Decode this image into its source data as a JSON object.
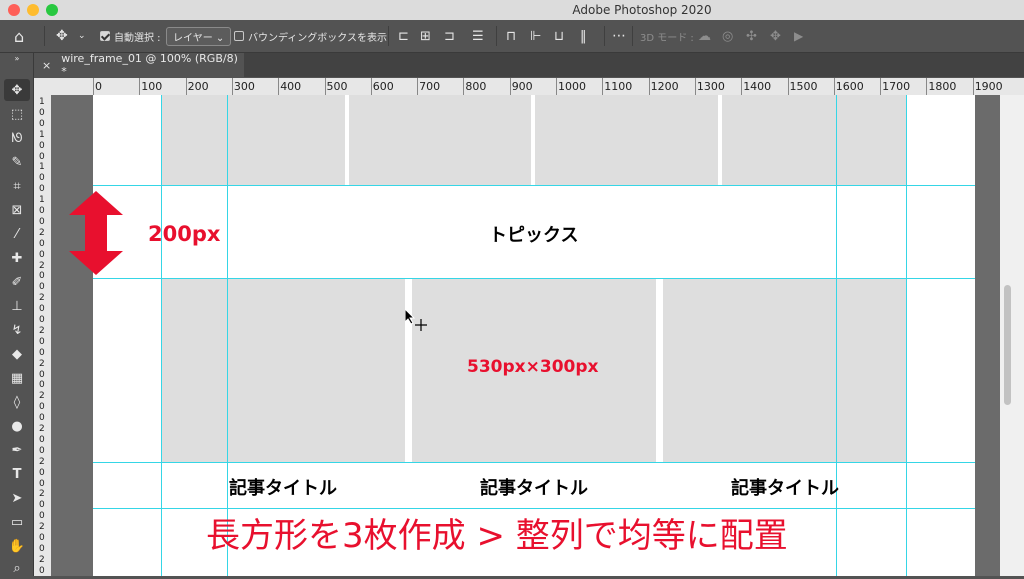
{
  "titlebar": {
    "title": "Adobe Photoshop 2020"
  },
  "options": {
    "auto_select": "自動選択 :",
    "layer_select": "レイヤー",
    "show_bbox": "バウンディングボックスを表示",
    "mode_3d": "3D モード :"
  },
  "document": {
    "tab_title": "wire_frame_01 @ 100% (RGB/8) *"
  },
  "ruler_h": [
    "0",
    "100",
    "200",
    "300",
    "400",
    "500",
    "600",
    "700",
    "800",
    "900",
    "1000",
    "1100",
    "1200",
    "1300",
    "1400",
    "1500",
    "1600",
    "1700",
    "1800",
    "1900"
  ],
  "ruler_v_digits": [
    "1",
    "0",
    "0",
    "1",
    "0",
    "0",
    "1",
    "0",
    "0",
    "1",
    "0",
    "0",
    "2",
    "0",
    "0",
    "2",
    "0",
    "0",
    "2",
    "0",
    "0",
    "2",
    "0",
    "0",
    "2",
    "0",
    "0",
    "2",
    "0",
    "0",
    "2",
    "0",
    "0",
    "2",
    "0",
    "0",
    "2",
    "0",
    "0",
    "2",
    "0",
    "0",
    "2",
    "0"
  ],
  "canvas": {
    "topics_heading": "トピックス",
    "height_label": "200px",
    "size_label": "530px×300px",
    "article_titles": [
      "記事タイトル",
      "記事タイトル",
      "記事タイトル"
    ],
    "caption": "長方形を3枚作成 > 整列で均等に配置"
  },
  "colors": {
    "accent_red": "#e8102e",
    "guide": "#35d6e6",
    "placeholder": "#dedede"
  }
}
